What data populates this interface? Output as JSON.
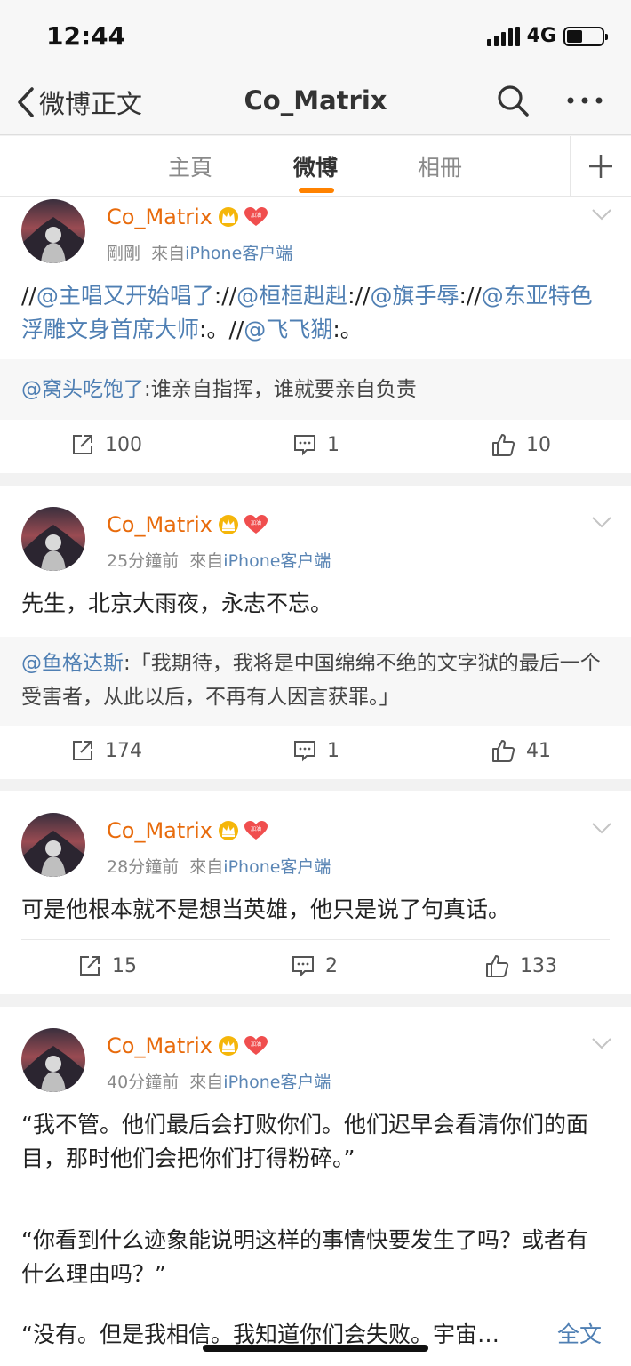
{
  "status_bar": {
    "time": "12:44",
    "network": "4G",
    "battery_level": 0.45
  },
  "navbar": {
    "back_label": "微博正文",
    "title": "Co_Matrix",
    "search_icon": "search-icon",
    "more_icon": "more-icon"
  },
  "tabs": [
    {
      "label": "主頁",
      "active": false
    },
    {
      "label": "微博",
      "active": true
    },
    {
      "label": "相冊",
      "active": false
    }
  ],
  "colors": {
    "username": "#e86b0c",
    "mention": "#4f7fb3",
    "tab_indicator": "#ff8200"
  },
  "posts": [
    {
      "username": "Co_Matrix",
      "time": "剛剛",
      "source_prefix": "來自",
      "source": "iPhone客户端",
      "body_parts": [
        {
          "text": "//"
        },
        {
          "text": "@主唱又开始唱了",
          "mention": true
        },
        {
          "text": "://"
        },
        {
          "text": "@桓桓赳赳",
          "mention": true
        },
        {
          "text": "://"
        },
        {
          "text": "@旗手辱",
          "mention": true
        },
        {
          "text": "://"
        },
        {
          "text": "@东亚特色浮雕文身首席大师",
          "mention": true
        },
        {
          "text": ":。//"
        },
        {
          "text": "@飞飞猢",
          "mention": true
        },
        {
          "text": ":。"
        }
      ],
      "quote": {
        "mention": "@窝头吃饱了",
        "text": ":谁亲自指挥，谁就要亲自负责"
      },
      "reposts": "100",
      "comments": "1",
      "likes": "10"
    },
    {
      "username": "Co_Matrix",
      "time": "25分鐘前",
      "source_prefix": "來自",
      "source": "iPhone客户端",
      "body": "先生，北京大雨夜，永志不忘。",
      "quote": {
        "mention": "@鱼格达斯",
        "text": ":「我期待，我将是中国绵绵不绝的文字狱的最后一个受害者，从此以后，不再有人因言获罪。」"
      },
      "reposts": "174",
      "comments": "1",
      "likes": "41"
    },
    {
      "username": "Co_Matrix",
      "time": "28分鐘前",
      "source_prefix": "來自",
      "source": "iPhone客户端",
      "body": "可是他根本就不是想当英雄，他只是说了句真话。",
      "reposts": "15",
      "comments": "2",
      "likes": "133"
    },
    {
      "username": "Co_Matrix",
      "time": "40分鐘前",
      "source_prefix": "來自",
      "source": "iPhone客户端",
      "paragraph1": "“我不管。他们最后会打败你们。他们迟早会看清你们的面目，那时他们会把你们打得粉碎。”",
      "paragraph2": "“你看到什么迹象能说明这样的事情快要发生了吗？或者有什么理由吗？”",
      "paragraph3": "“没有。但是我相信。我知道你们会失败。宇宙…",
      "full_text_link": "全文"
    }
  ]
}
